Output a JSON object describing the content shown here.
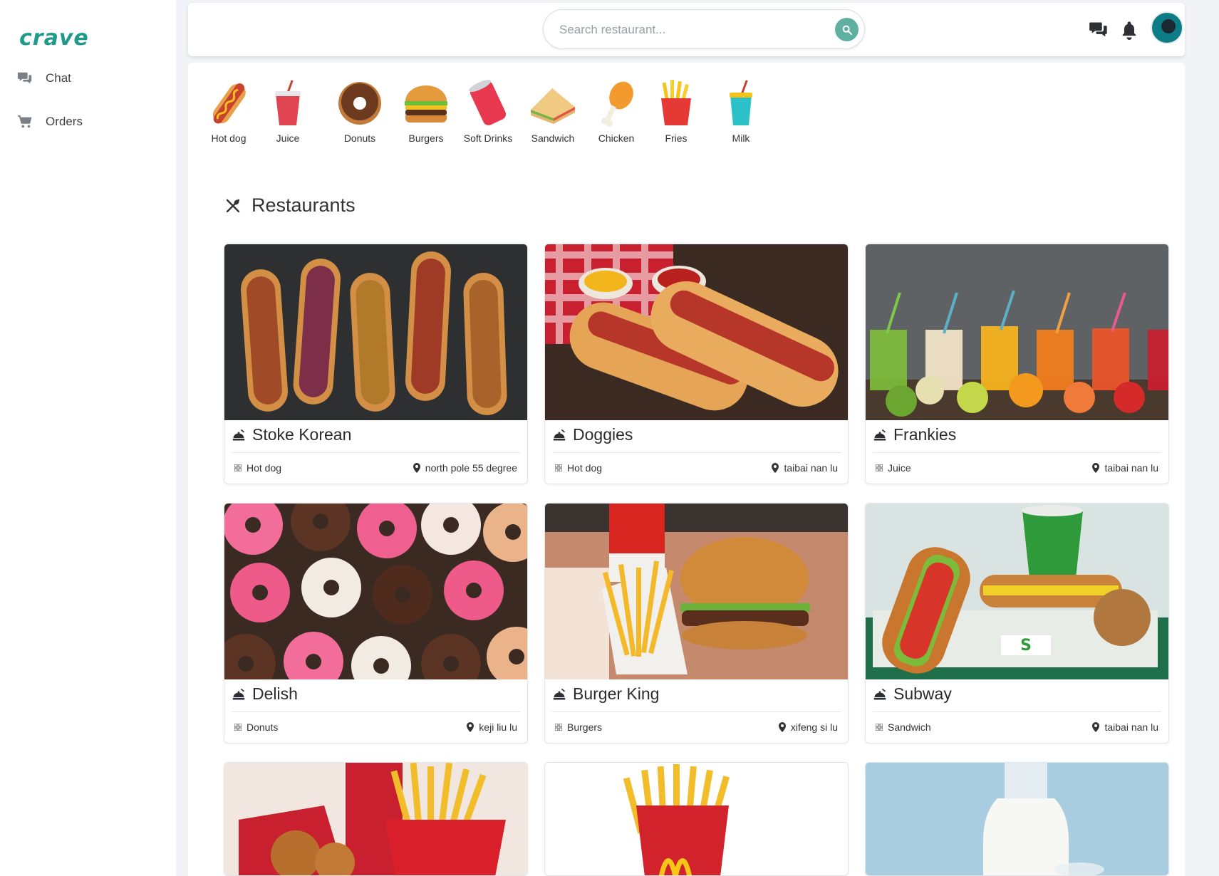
{
  "app": {
    "logo": "crave"
  },
  "sidebar": {
    "items": [
      {
        "label": "Chat",
        "icon": "chat-bubbles-icon"
      },
      {
        "label": "Orders",
        "icon": "cart-icon"
      }
    ]
  },
  "header": {
    "search": {
      "placeholder": "Search restaurant..."
    },
    "icons": [
      "chat-bubbles-icon",
      "bell-icon",
      "avatar"
    ]
  },
  "categories": [
    {
      "label": "Hot dog",
      "icon": "hotdog-icon"
    },
    {
      "label": "Juice",
      "icon": "juice-cup-icon"
    },
    {
      "label": "Donuts",
      "icon": "donut-icon"
    },
    {
      "label": "Burgers",
      "icon": "burger-icon"
    },
    {
      "label": "Soft Drinks",
      "icon": "soda-can-icon"
    },
    {
      "label": "Sandwich",
      "icon": "sandwich-icon"
    },
    {
      "label": "Chicken",
      "icon": "chicken-leg-icon"
    },
    {
      "label": "Fries",
      "icon": "fries-icon"
    },
    {
      "label": "Milk",
      "icon": "milk-cup-icon"
    }
  ],
  "restaurants_section": {
    "title": "Restaurants",
    "icon": "utensils-crossed-icon"
  },
  "restaurants": [
    {
      "name": "Stoke Korean",
      "category": "Hot dog",
      "location": "north pole 55 degree"
    },
    {
      "name": "Doggies",
      "category": "Hot dog",
      "location": "taibai nan lu"
    },
    {
      "name": "Frankies",
      "category": "Juice",
      "location": "taibai nan lu"
    },
    {
      "name": "Delish",
      "category": "Donuts",
      "location": "keji liu lu"
    },
    {
      "name": "Burger King",
      "category": "Burgers",
      "location": "xifeng si lu"
    },
    {
      "name": "Subway",
      "category": "Sandwich",
      "location": "taibai nan lu"
    }
  ],
  "colors": {
    "brand": "#1f9a8a",
    "search_button": "#5fb0a2",
    "background": "#f2f3f6"
  }
}
